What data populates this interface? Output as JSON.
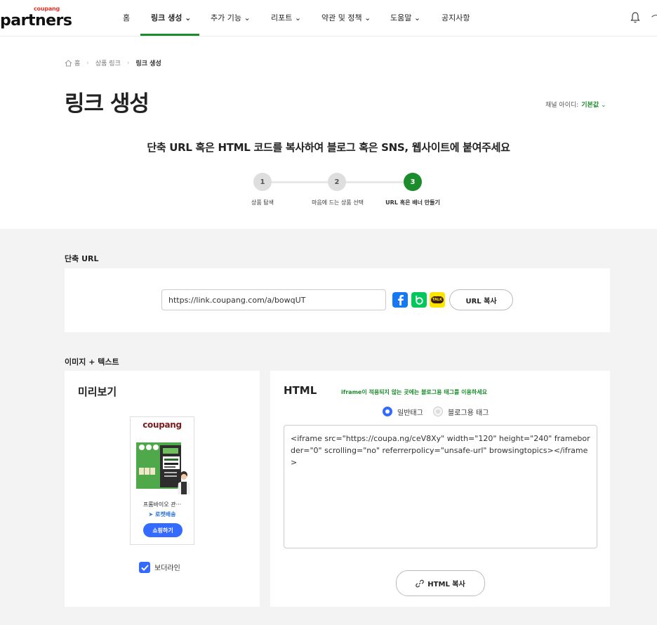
{
  "header": {
    "logo_small": "coupang",
    "logo_big": "partners",
    "nav": [
      {
        "label": "홈",
        "chevron": false,
        "active": false
      },
      {
        "label": "링크 생성",
        "chevron": true,
        "active": true
      },
      {
        "label": "추가 기능",
        "chevron": true,
        "active": false
      },
      {
        "label": "리포트",
        "chevron": true,
        "active": false
      },
      {
        "label": "약관 및 정책",
        "chevron": true,
        "active": false
      },
      {
        "label": "도움말",
        "chevron": true,
        "active": false
      },
      {
        "label": "공지사항",
        "chevron": false,
        "active": false
      }
    ]
  },
  "breadcrumb": {
    "home": "홈",
    "item1": "상품 링크",
    "current": "링크 생성"
  },
  "page": {
    "title": "링크 생성",
    "channel_label": "채널 아이디:",
    "channel_value": "기본값",
    "instruction": "단축 URL 혹은 HTML 코드를 복사하여 블로그 혹은 SNS, 웹사이트에 붙여주세요"
  },
  "steps": [
    {
      "number": "1",
      "label": "상품 탐색",
      "active": false
    },
    {
      "number": "2",
      "label": "마음에 드는 상품 선택",
      "active": false
    },
    {
      "number": "3",
      "label": "URL 혹은 배너 만들기",
      "active": true
    }
  ],
  "short_url": {
    "section_label": "단축 URL",
    "value": "https://link.coupang.com/a/bowqUT",
    "copy_button": "URL 복사",
    "kakao_badge": "TALK"
  },
  "image_text": {
    "section_label": "이미지 + 텍스트",
    "preview_title": "미리보기",
    "banner": {
      "logo": "coupang",
      "product_name": "프롬바이오 관···",
      "rocket": "로켓배송",
      "shop_button": "쇼핑하기"
    },
    "border_label": "보더라인",
    "border_checked": true,
    "html_title": "HTML",
    "notice": "iframe이 적용되지 않는 곳에는 블로그용 태그를 이용하세요",
    "radio_normal": "일반태그",
    "radio_blog": "블로그용 태그",
    "selected_tag": "일반태그",
    "code": "<iframe src=\"https://coupa.ng/ceV8Xy\" width=\"120\" height=\"240\" frameborder=\"0\" scrolling=\"no\" referrerpolicy=\"unsafe-url\" browsingtopics></iframe>",
    "html_copy_button": "HTML 복사"
  },
  "colors": {
    "brand_green": "#1b8c2c",
    "accent_blue": "#346aff",
    "background_gray": "#f3f3f3"
  }
}
